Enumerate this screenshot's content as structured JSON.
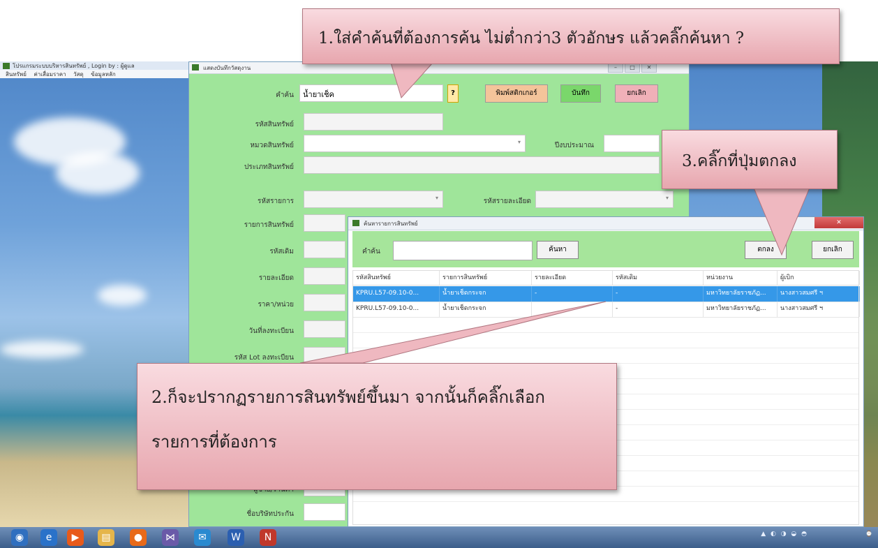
{
  "main_window": {
    "title": "โปรแกรมระบบบริหารสินทรัพย์ , Login by : ผู้ดูแล",
    "menu": [
      "สินทรัพย์",
      "ค่าเสื่อมราคา",
      "วัสดุ",
      "ข้อมูลหลัก"
    ]
  },
  "form_window": {
    "title": "แสดงบันทึกวัสดุงาน",
    "labels": {
      "keyword": "คำค้น",
      "asset_code": "รหัสสินทรัพย์",
      "asset_category": "หมวดสินทรัพย์",
      "budget_year": "ปีงบประมาณ",
      "asset_type": "ประเภทสินทรัพย์",
      "item_code": "รหัสรายการ",
      "detail_code": "รหัสรายละเอียด",
      "asset_list": "รายการสินทรัพย์",
      "old_code": "รหัสเดิม",
      "detail": "รายละเอียด",
      "unit_price": "ราคา/หน่วย",
      "register_date": "วันที่ลงทะเบียน",
      "lot_code": "รหัส Lot ลงทะเบียน",
      "vendor": "ผู้ขาย/ร้านค้า",
      "insurance_name": "ชื่อบริษัทประกัน"
    },
    "keyword_value": "น้ำยาเช็ค",
    "buttons": {
      "search": "?",
      "print": "พิมพ์สติกเกอร์",
      "save": "บันทึก",
      "cancel": "ยกเลิก"
    }
  },
  "dialog": {
    "title": "ค้นหารายการสินทรัพย์",
    "search_label": "คำค้น",
    "search_value": "",
    "search_button": "ค้นหา",
    "ok_button": "ตกลง",
    "cancel_button": "ยกเลิก",
    "columns": [
      "รหัสสินทรัพย์",
      "รายการสินทรัพย์",
      "รายละเอียด",
      "รหัสเดิม",
      "หน่วยงาน",
      "ผู้เบิก"
    ],
    "rows": [
      [
        "KPRU.L57-09.10-0...",
        "น้ำยาเช็ดกระจก",
        "-",
        "-",
        "มหาวิทยาลัยราชภัฏ...",
        "นางสาวสมศรี ฯ"
      ],
      [
        "KPRU.L57-09.10-0...",
        "น้ำยาเช็ดกระจก",
        "",
        "-",
        "มหาวิทยาลัยราชภัฏ...",
        "นางสาวสมศรี ฯ"
      ]
    ],
    "selected_row": 0
  },
  "callouts": {
    "step1": "1.ใส่คำค้นที่ต้องการค้น ไม่ต่ำกว่า3 ตัวอักษร แล้วคลิ๊กค้นหา ?",
    "step2_line1": "2.ก็จะปรากฏรายการสินทรัพย์ขึ้นมา จากนั้นก็คลิ๊กเลือก",
    "step2_line2": "รายการที่ต้องการ",
    "step3": "3.คลิ๊กที่ปุ่มตกลง"
  },
  "colors": {
    "form_bg": "#9fe59a",
    "selected_row": "#3598e8",
    "callout": "#f3c6cc"
  }
}
